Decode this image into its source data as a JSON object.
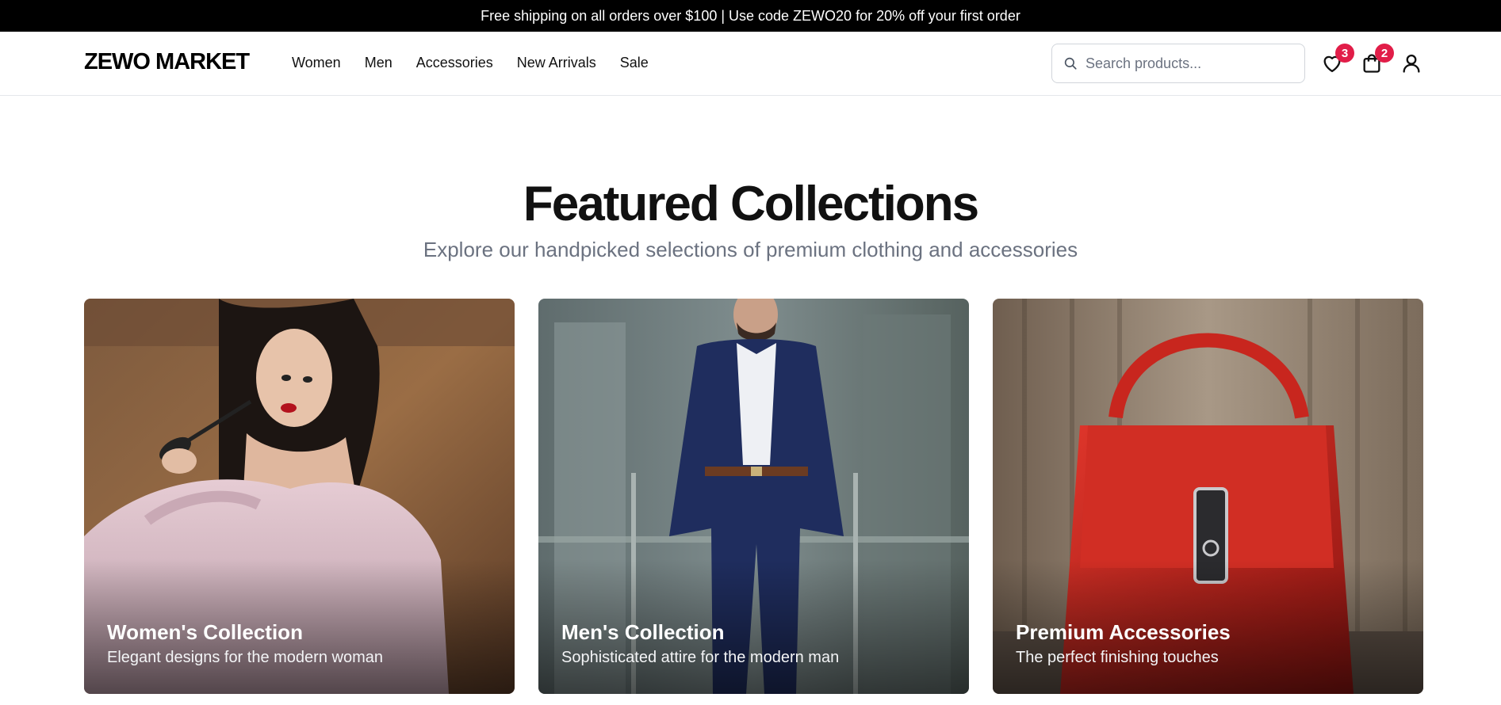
{
  "announcement": "Free shipping on all orders over $100 | Use code ZEWO20 for 20% off your first order",
  "header": {
    "logo": "ZEWO MARKET",
    "nav": [
      "Women",
      "Men",
      "Accessories",
      "New Arrivals",
      "Sale"
    ],
    "search_placeholder": "Search products...",
    "wishlist_count": "3",
    "cart_count": "2",
    "icons": [
      "search-icon",
      "heart-icon",
      "shopping-bag-icon",
      "user-icon"
    ]
  },
  "hero": {
    "title": "Featured Collections",
    "subtitle": "Explore our handpicked selections of premium clothing and accessories"
  },
  "collections": [
    {
      "title": "Women's Collection",
      "description": "Elegant designs for the modern woman"
    },
    {
      "title": "Men's Collection",
      "description": "Sophisticated attire for the modern man"
    },
    {
      "title": "Premium Accessories",
      "description": "The perfect finishing touches"
    }
  ],
  "colors": {
    "announcement_bg": "#000000",
    "badge": "#e11d48",
    "subtitle": "#6b7280"
  }
}
